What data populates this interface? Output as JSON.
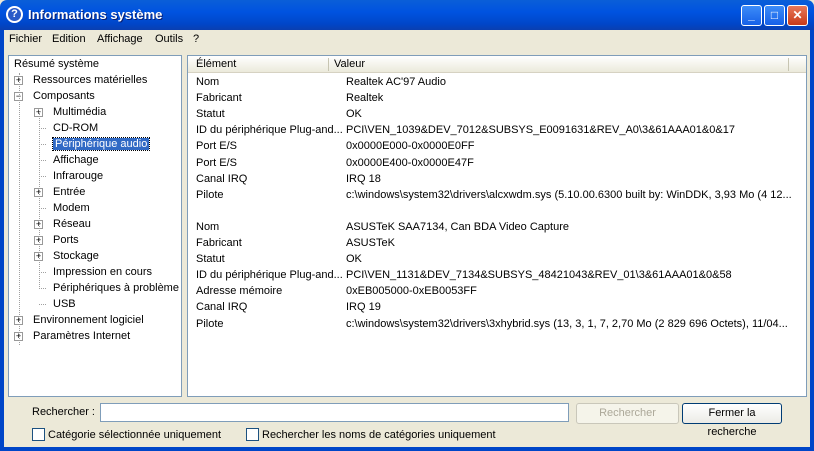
{
  "window": {
    "title": "Informations système"
  },
  "menu": [
    "Fichier",
    "Edition",
    "Affichage",
    "Outils",
    "?"
  ],
  "tree": {
    "root": "Résumé système",
    "items": [
      {
        "label": "Ressources matérielles",
        "level": 1,
        "expander": "+"
      },
      {
        "label": "Composants",
        "level": 1,
        "expander": "-"
      },
      {
        "label": "Multimédia",
        "level": 2,
        "expander": "+"
      },
      {
        "label": "CD-ROM",
        "level": 2,
        "expander": ""
      },
      {
        "label": "Périphérique audio",
        "level": 2,
        "expander": "",
        "selected": true
      },
      {
        "label": "Affichage",
        "level": 2,
        "expander": ""
      },
      {
        "label": "Infrarouge",
        "level": 2,
        "expander": ""
      },
      {
        "label": "Entrée",
        "level": 2,
        "expander": "+"
      },
      {
        "label": "Modem",
        "level": 2,
        "expander": ""
      },
      {
        "label": "Réseau",
        "level": 2,
        "expander": "+"
      },
      {
        "label": "Ports",
        "level": 2,
        "expander": "+"
      },
      {
        "label": "Stockage",
        "level": 2,
        "expander": "+"
      },
      {
        "label": "Impression en cours",
        "level": 2,
        "expander": ""
      },
      {
        "label": "Périphériques à problème",
        "level": 2,
        "expander": ""
      },
      {
        "label": "USB",
        "level": 2,
        "expander": ""
      },
      {
        "label": "Environnement logiciel",
        "level": 1,
        "expander": "+"
      },
      {
        "label": "Paramètres Internet",
        "level": 1,
        "expander": "+"
      }
    ]
  },
  "table": {
    "columns": [
      "Élément",
      "Valeur"
    ],
    "rows": [
      {
        "k": "Nom",
        "v": "Realtek AC'97 Audio"
      },
      {
        "k": "Fabricant",
        "v": "Realtek"
      },
      {
        "k": "Statut",
        "v": "OK"
      },
      {
        "k": "ID du périphérique Plug-and...",
        "v": "PCI\\VEN_1039&DEV_7012&SUBSYS_E0091631&REV_A0\\3&61AAA01&0&17"
      },
      {
        "k": "Port E/S",
        "v": "0x0000E000-0x0000E0FF"
      },
      {
        "k": "Port E/S",
        "v": "0x0000E400-0x0000E47F"
      },
      {
        "k": "Canal IRQ",
        "v": "IRQ 18"
      },
      {
        "k": "Pilote",
        "v": "c:\\windows\\system32\\drivers\\alcxwdm.sys (5.10.00.6300 built by: WinDDK, 3,93 Mo (4 12..."
      },
      {
        "k": "",
        "v": ""
      },
      {
        "k": "Nom",
        "v": "ASUSTeK SAA7134, Can BDA Video Capture"
      },
      {
        "k": "Fabricant",
        "v": "ASUSTeK"
      },
      {
        "k": "Statut",
        "v": "OK"
      },
      {
        "k": "ID du périphérique Plug-and...",
        "v": "PCI\\VEN_1131&DEV_7134&SUBSYS_48421043&REV_01\\3&61AAA01&0&58"
      },
      {
        "k": "Adresse mémoire",
        "v": "0xEB005000-0xEB0053FF"
      },
      {
        "k": "Canal IRQ",
        "v": "IRQ 19"
      },
      {
        "k": "Pilote",
        "v": "c:\\windows\\system32\\drivers\\3xhybrid.sys (13, 3, 1, 7, 2,70 Mo (2 829 696 Octets), 11/04..."
      }
    ]
  },
  "search": {
    "label": "Rechercher :",
    "value": "",
    "search_button": "Rechercher",
    "close_button": "Fermer la recherche",
    "cb_selected_category": "Catégorie sélectionnée uniquement",
    "cb_category_names": "Rechercher les noms de catégories uniquement"
  }
}
